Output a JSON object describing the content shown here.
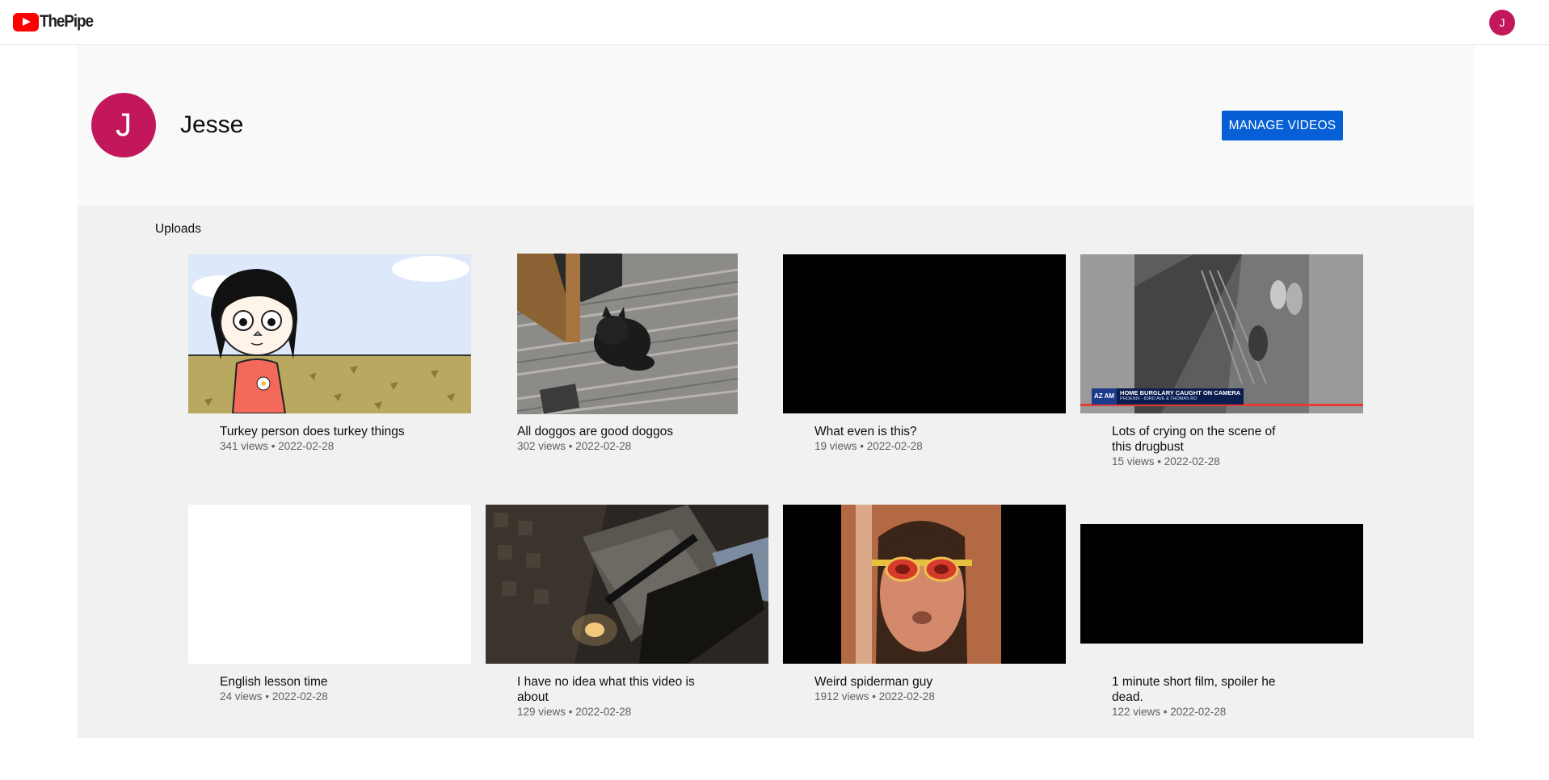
{
  "app": {
    "name": "ThePipe",
    "user_initial": "J"
  },
  "channel": {
    "initial": "J",
    "name": "Jesse",
    "manage_label": "MANAGE VIDEOS"
  },
  "uploads": {
    "title": "Uploads",
    "videos": [
      {
        "title": "Turkey person does turkey things",
        "meta": "341 views • 2022-02-28"
      },
      {
        "title": "All doggos are good doggos",
        "meta": "302 views • 2022-02-28"
      },
      {
        "title": "What even is this?",
        "meta": "19 views • 2022-02-28"
      },
      {
        "title": "Lots of crying on the scene of this drugbust",
        "meta": "15 views • 2022-02-28",
        "overlay": {
          "badge": "AZ AM",
          "headline": "HOME BURGLARY CAUGHT ON CAMERA",
          "subline": "PHOENIX - 83RD AVE & THOMAS RD"
        }
      },
      {
        "title": "English lesson time",
        "meta": "24 views • 2022-02-28"
      },
      {
        "title": "I have no idea what this video is about",
        "meta": "129 views • 2022-02-28"
      },
      {
        "title": "Weird spiderman guy",
        "meta": "1912 views • 2022-02-28"
      },
      {
        "title": "1 minute short film, spoiler he dead.",
        "meta": "122 views • 2022-02-28"
      }
    ]
  }
}
